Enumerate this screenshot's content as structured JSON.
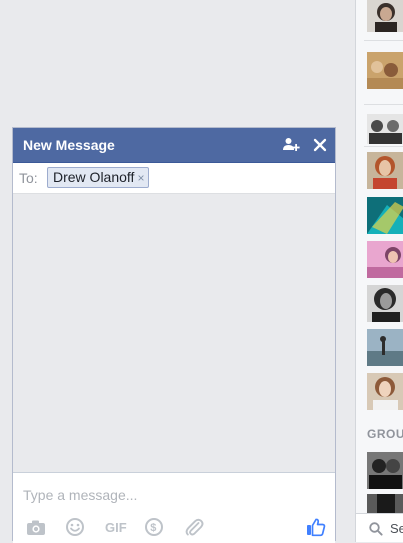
{
  "chat": {
    "title": "New Message",
    "to_label": "To:",
    "recipient": "Drew Olanoff",
    "remove_symbol": "×",
    "composer_placeholder": "Type a message..."
  },
  "toolbar": {
    "icons": [
      "camera-icon",
      "sticker-icon",
      "gif-icon",
      "payment-icon",
      "attachment-icon",
      "like-icon"
    ],
    "gif_label": "GIF",
    "pay_symbol": "$"
  },
  "sidebar": {
    "group_heading": "GROU",
    "search_placeholder": "Se"
  },
  "colors": {
    "header": "#4e69a2",
    "accent": "#4080ff",
    "background": "#e9eaed"
  }
}
